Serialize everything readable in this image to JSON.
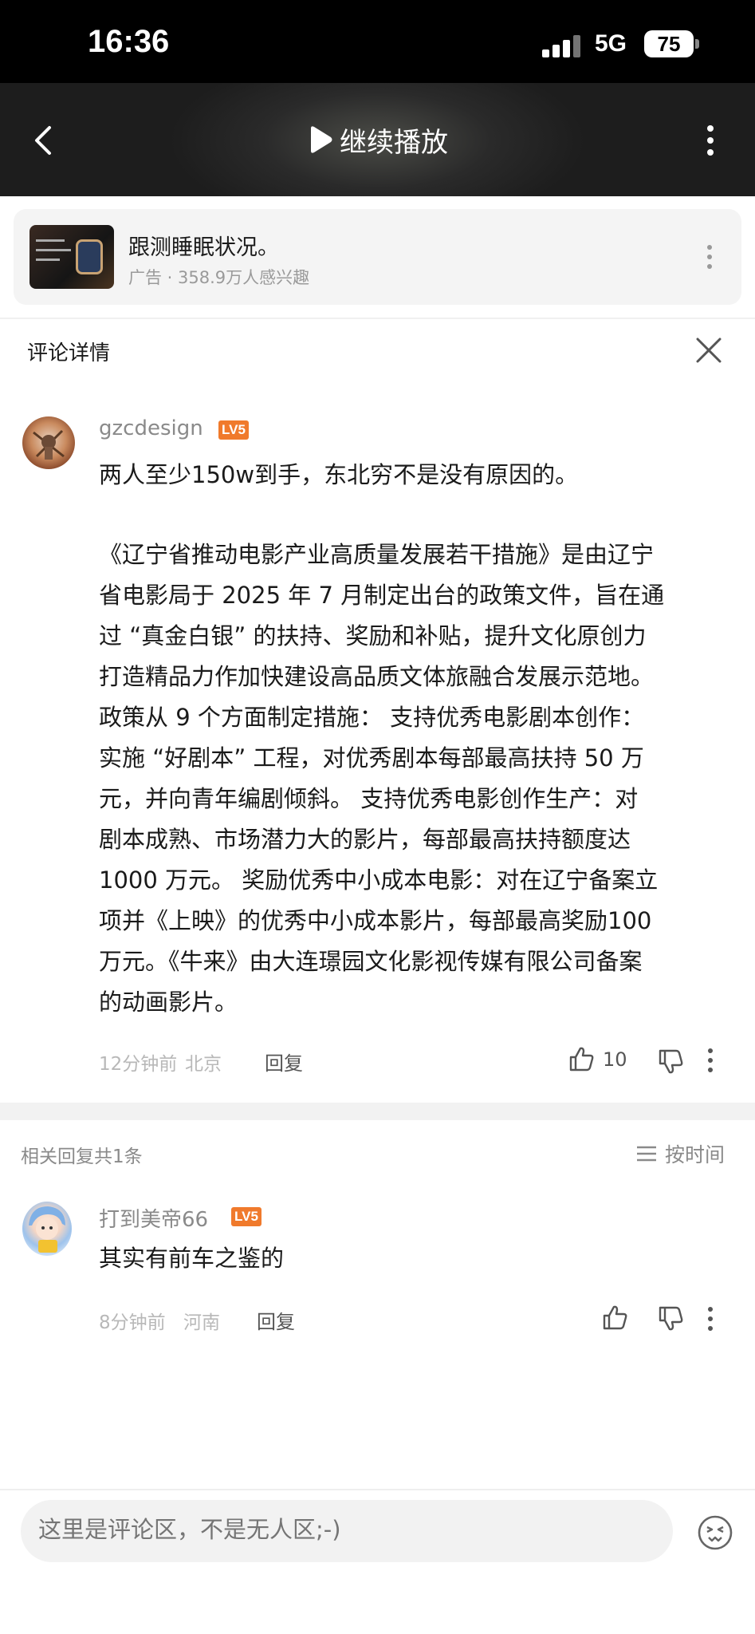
{
  "status_bar": {
    "time": "16:36",
    "network": "5G",
    "battery": "75"
  },
  "nav": {
    "title": "继续播放"
  },
  "ad": {
    "title": "跟测睡眠状况。",
    "subtitle": "广告 · 358.9万人感兴趣"
  },
  "comment_detail": {
    "title": "评论详情"
  },
  "main_comment": {
    "username": "gzcdesign",
    "level": "LV5",
    "first_line": "两人至少150w到手，东北穷不是没有原因的。",
    "body_lines": [
      "《辽宁省推动电影产业高质量发展若干措施》是由辽宁",
      "省电影局于 2025 年 7 月制定出台的政策文件，旨在通",
      "过 “真金白银” 的扶持、奖励和补贴，提升文化原创力",
      "打造精品力作加快建设高品质文体旅融合发展示范地。",
      "政策从 9 个方面制定措施： 支持优秀电影剧本创作：",
      "实施 “好剧本” 工程，对优秀剧本每部最高扶持 50 万",
      "元，并向青年编剧倾斜。 支持优秀电影创作生产：对",
      "剧本成熟、市场潜力大的影片，每部最高扶持额度达",
      "1000 万元。 奖励优秀中小成本电影：对在辽宁备案立",
      "项并《上映》的优秀中小成本影片，每部最高奖励100",
      "万元。《牛来》由大连璟园文化影视传媒有限公司备案",
      "的动画影片。"
    ],
    "time": "12分钟前",
    "location": "北京",
    "reply_label": "回复",
    "likes": "10"
  },
  "related": {
    "label": "相关回复共1条",
    "sort_label": "按时间"
  },
  "reply_comment": {
    "username": "打到美帝66",
    "level": "LV5",
    "text": "其实有前车之鉴的",
    "time": "8分钟前",
    "location": "河南",
    "reply_label": "回复"
  },
  "input": {
    "placeholder": "这里是评论区，不是无人区;-)"
  },
  "colors": {
    "accent_level": "#f07a2c",
    "muted": "#8a8a8a",
    "text": "#1a1a1a"
  },
  "icons": [
    "back-icon",
    "play-icon",
    "more-icon",
    "close-icon",
    "thumbs-up-icon",
    "thumbs-down-icon",
    "sort-icon",
    "emoji-icon"
  ]
}
